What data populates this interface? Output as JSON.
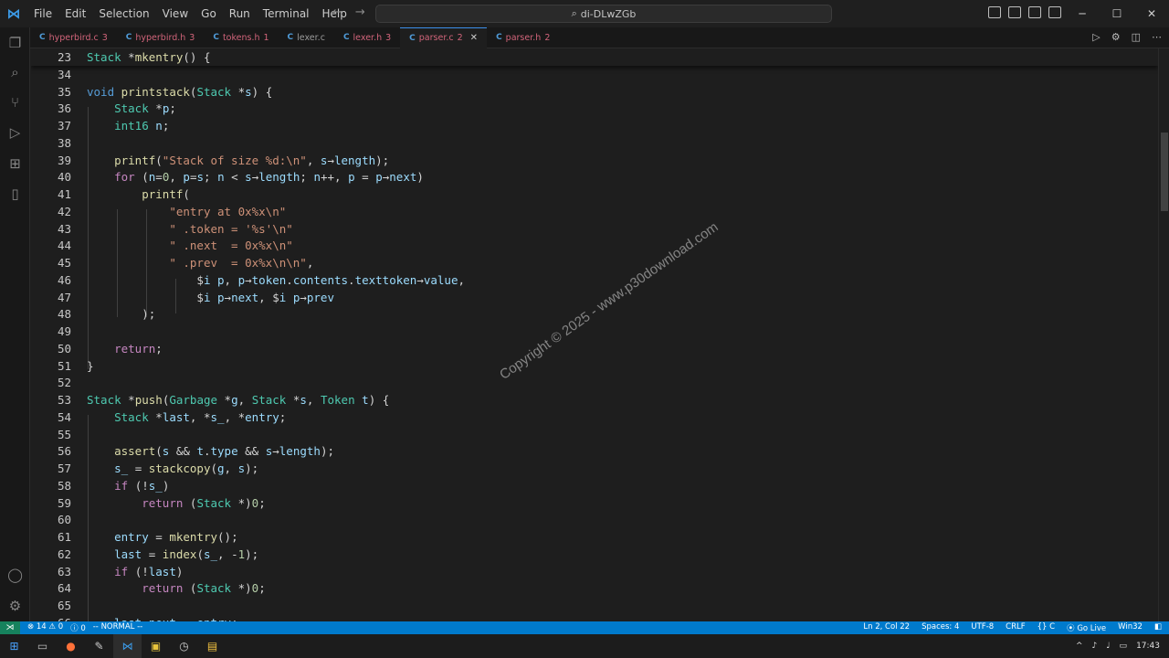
{
  "menu": [
    "File",
    "Edit",
    "Selection",
    "View",
    "Go",
    "Run",
    "Terminal",
    "Help"
  ],
  "search": {
    "text": "di-DLwZGb"
  },
  "tabs": [
    {
      "label": "hyperbird.c",
      "badge": "3",
      "style": "err"
    },
    {
      "label": "hyperbird.h",
      "badge": "3",
      "style": "err"
    },
    {
      "label": "tokens.h",
      "badge": "1",
      "style": "err"
    },
    {
      "label": "lexer.c",
      "badge": "",
      "style": "norm"
    },
    {
      "label": "lexer.h",
      "badge": "3",
      "style": "err"
    },
    {
      "label": "parser.c",
      "badge": "2",
      "style": "active"
    },
    {
      "label": "parser.h",
      "badge": "2",
      "style": "err"
    }
  ],
  "code_lines": [
    {
      "n": "23",
      "text": "Stack *mkentry() {",
      "sticky": true
    },
    {
      "n": "34",
      "text": ""
    },
    {
      "n": "35",
      "text": "void printstack(Stack *s) {"
    },
    {
      "n": "36",
      "text": "    Stack *p;"
    },
    {
      "n": "37",
      "text": "    int16 n;"
    },
    {
      "n": "38",
      "text": ""
    },
    {
      "n": "39",
      "text": "    printf(\"Stack of size %d:\\n\", s→length);"
    },
    {
      "n": "40",
      "text": "    for (n=0, p=s; n < s→length; n++, p = p→next)"
    },
    {
      "n": "41",
      "text": "        printf("
    },
    {
      "n": "42",
      "text": "            \"entry at 0x%x\\n\""
    },
    {
      "n": "43",
      "text": "            \" .token = '%s'\\n\""
    },
    {
      "n": "44",
      "text": "            \" .next  = 0x%x\\n\""
    },
    {
      "n": "45",
      "text": "            \" .prev  = 0x%x\\n\\n\","
    },
    {
      "n": "46",
      "text": "                $i p, p→token.contents.texttoken→value,"
    },
    {
      "n": "47",
      "text": "                $i p→next, $i p→prev"
    },
    {
      "n": "48",
      "text": "        );"
    },
    {
      "n": "49",
      "text": ""
    },
    {
      "n": "50",
      "text": "    return;"
    },
    {
      "n": "51",
      "text": "}"
    },
    {
      "n": "52",
      "text": ""
    },
    {
      "n": "53",
      "text": "Stack *push(Garbage *g, Stack *s, Token t) {"
    },
    {
      "n": "54",
      "text": "    Stack *last, *s_, *entry;"
    },
    {
      "n": "55",
      "text": ""
    },
    {
      "n": "56",
      "text": "    assert(s && t.type && s→length);"
    },
    {
      "n": "57",
      "text": "    s_ = stackcopy(g, s);"
    },
    {
      "n": "58",
      "text": "    if (!s_)"
    },
    {
      "n": "59",
      "text": "        return (Stack *)0;"
    },
    {
      "n": "60",
      "text": ""
    },
    {
      "n": "61",
      "text": "    entry = mkentry();"
    },
    {
      "n": "62",
      "text": "    last = index(s_, -1);"
    },
    {
      "n": "63",
      "text": "    if (!last)"
    },
    {
      "n": "64",
      "text": "        return (Stack *)0;"
    },
    {
      "n": "65",
      "text": ""
    },
    {
      "n": "66",
      "text": "    last→next = entry;"
    }
  ],
  "watermark": "Copyright © 2025 - www.p30download.com",
  "status": {
    "errors": "14",
    "warnings": "0",
    "info": "0",
    "mode": "-- NORMAL --",
    "position": "Ln 2, Col 22",
    "spaces": "Spaces: 4",
    "encoding": "UTF-8",
    "eol": "CRLF",
    "language": "C",
    "golive": "Go Live",
    "platform": "Win32"
  },
  "taskbar": {
    "time": "17:43"
  },
  "colors": {
    "statusbar": "#007acc",
    "accent": "#3b8eea",
    "error_tab": "#d1647a"
  }
}
